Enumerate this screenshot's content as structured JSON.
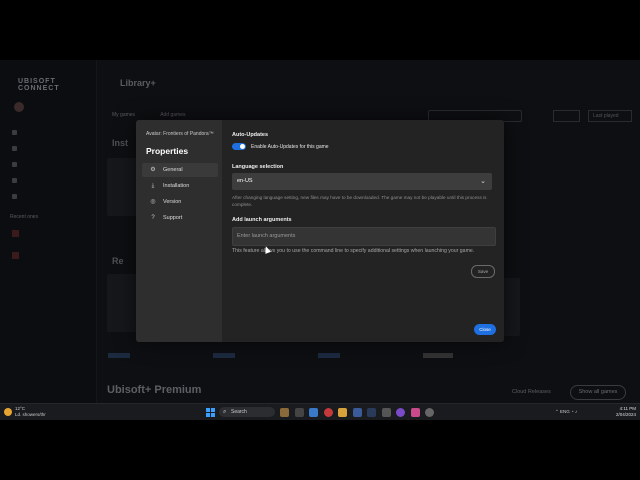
{
  "background_app": {
    "brand": "UBISOFT CONNECT",
    "page_title": "Library+",
    "tabs": [
      "My games",
      "Add games"
    ],
    "sort_label": "Last played",
    "section_1": "Inst",
    "section_2": "Re",
    "premium_title": "Ubisoft+ Premium",
    "premium_link": "Cloud Releases",
    "show_all": "Show all games",
    "recent_heading": "Recent ones"
  },
  "dialog": {
    "game_name": "Avatar: Frontiers of Pandora™",
    "title": "Properties",
    "menu": [
      {
        "icon": "gear-icon",
        "glyph": "⚙",
        "label": "General"
      },
      {
        "icon": "download-icon",
        "glyph": "⤓",
        "label": "Installation"
      },
      {
        "icon": "version-icon",
        "glyph": "◎",
        "label": "Version"
      },
      {
        "icon": "support-icon",
        "glyph": "?",
        "label": "Support"
      }
    ],
    "auto_updates": {
      "heading": "Auto-Updates",
      "toggle_label": "Enable Auto-Updates for this game",
      "enabled": true
    },
    "language": {
      "heading": "Language selection",
      "value": "en-US",
      "note": "After changing language setting, new files may have to be downloaded. The game may not be playable until this process is complete."
    },
    "launch_args": {
      "heading": "Add launch arguments",
      "placeholder": "Enter launch arguments",
      "description": "This feature allows you to use the command line to specify additional settings when launching your game.",
      "save_label": "Save"
    },
    "close_label": "Close"
  },
  "taskbar": {
    "weather_temp": "12°C",
    "weather_desc": "Ld. showers/thr",
    "search_label": "Search",
    "language": "ENG",
    "time": "4:11 PM",
    "date": "2/04/2024"
  },
  "colors": {
    "accent": "#1e6fe0",
    "dialog_bg": "#232323",
    "dialog_sidebar": "#2e2e2e"
  }
}
